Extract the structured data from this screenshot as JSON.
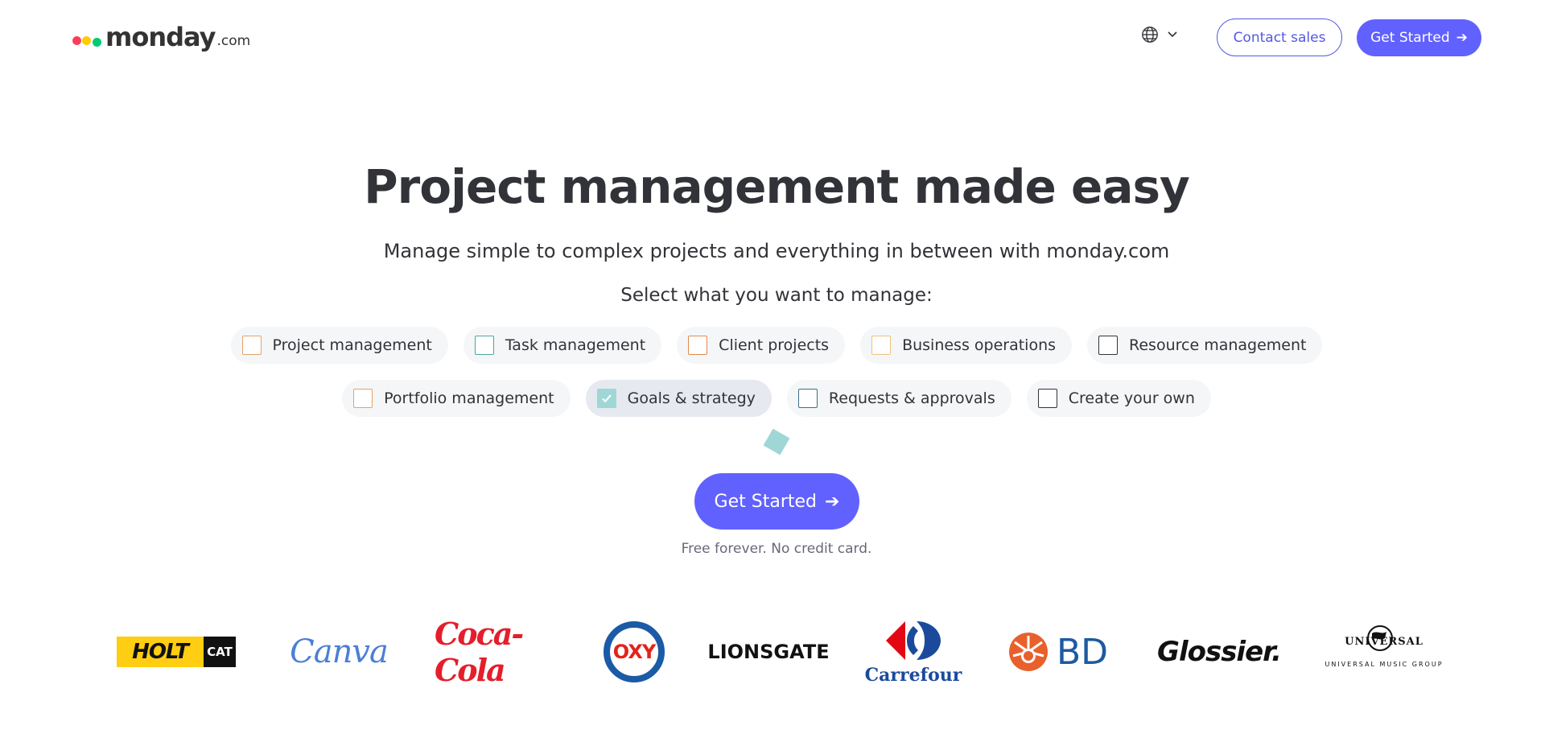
{
  "header": {
    "logo": {
      "name": "monday",
      "suffix": ".com",
      "colors": [
        "#ff3d57",
        "#ffcb00",
        "#00ca72"
      ]
    },
    "language_icon": "globe-icon",
    "contact_sales": "Contact sales",
    "get_started": "Get Started",
    "arrow": "➔"
  },
  "hero": {
    "title": "Project management made easy",
    "subtitle": "Manage simple to complex projects and everything in between with monday.com",
    "select_label": "Select what you want to manage:",
    "options": [
      {
        "label": "Project management",
        "color": "#e2a26a",
        "checked": false
      },
      {
        "label": "Task management",
        "color": "#4fa39d",
        "checked": false
      },
      {
        "label": "Client projects",
        "color": "#e0894e",
        "checked": false
      },
      {
        "label": "Business operations",
        "color": "#f0c27a",
        "checked": false
      },
      {
        "label": "Resource management",
        "color": "#323338",
        "checked": false
      },
      {
        "label": "Portfolio management",
        "color": "#e2a26a",
        "checked": false
      },
      {
        "label": "Goals & strategy",
        "color": "#9ed7d5",
        "checked": true
      },
      {
        "label": "Requests & approvals",
        "color": "#3d6f86",
        "checked": false
      },
      {
        "label": "Create your own",
        "color": "#323338",
        "checked": false
      }
    ],
    "cta": "Get Started",
    "cta_arrow": "➔",
    "note": "Free forever. No credit card."
  },
  "customers": {
    "holt": "HOLT",
    "cat": "CAT",
    "canva": "Canva",
    "cocacola": "Coca-Cola",
    "oxy": "OXY",
    "lionsgate": "LIONSGATE",
    "carrefour": "Carrefour",
    "bd": "BD",
    "glossier": "Glossier.",
    "universal": "UNIVERSAL",
    "umg": "UNIVERSAL MUSIC GROUP"
  }
}
